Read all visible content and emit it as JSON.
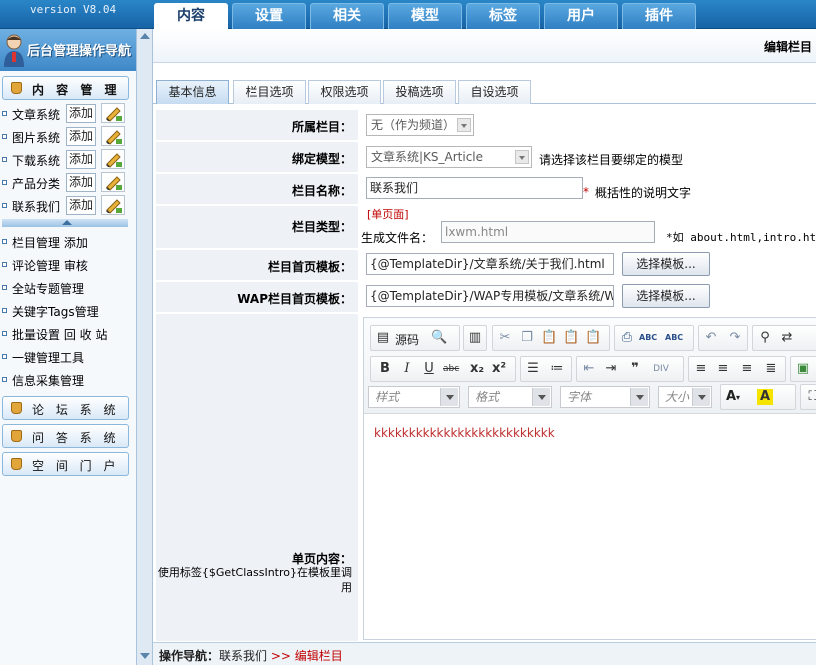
{
  "app": {
    "version": "version V8.04"
  },
  "top_tabs": [
    "内容",
    "设置",
    "相关",
    "模型",
    "标签",
    "用户",
    "插件"
  ],
  "sidebar": {
    "title": "后台管理操作导航",
    "content_section": "内 容 管 理",
    "systems": [
      {
        "label": "文章系统",
        "add": "添加"
      },
      {
        "label": "图片系统",
        "add": "添加"
      },
      {
        "label": "下载系统",
        "add": "添加"
      },
      {
        "label": "产品分类",
        "add": "添加"
      },
      {
        "label": "联系我们",
        "add": "添加"
      }
    ],
    "links": [
      "栏目管理 添加",
      "评论管理 审核",
      "全站专题管理",
      "关键字Tags管理",
      "批量设置 回 收 站",
      "一键管理工具",
      "信息采集管理"
    ],
    "other_sections": [
      "论 坛 系 统",
      "问 答 系 统",
      "空 间 门 户"
    ]
  },
  "page": {
    "title": "编辑栏目"
  },
  "sub_tabs": [
    "基本信息",
    "栏目选项",
    "权限选项",
    "投稿选项",
    "自设选项"
  ],
  "form": {
    "parent": {
      "label": "所属栏目：",
      "value": "无（作为频道）"
    },
    "model": {
      "label": "绑定模型：",
      "value": "文章系统|KS_Article",
      "hint": "请选择该栏目要绑定的模型"
    },
    "name": {
      "label": "栏目名称：",
      "value": "联系我们",
      "star": "*",
      "hint": "概括性的说明文字"
    },
    "type": {
      "label": "栏目类型：",
      "tag": "[单页面]",
      "filename_label": "生成文件名：",
      "filename_value": "lxwm.html",
      "hint": "*如 about.html,intro.html"
    },
    "home_tpl": {
      "label": "栏目首页模板：",
      "value": "{@TemplateDir}/文章系统/关于我们.html",
      "button": "选择模板..."
    },
    "wap_tpl": {
      "label": "WAP栏目首页模板：",
      "value": "{@TemplateDir}/WAP专用模板/文章系统/W",
      "button": "选择模板..."
    },
    "content": {
      "label": "单页内容：",
      "note": "使用标签{$GetClassIntro}在模板里调用"
    }
  },
  "editor": {
    "source_label": "源码",
    "style_placeholder": "样式",
    "format_placeholder": "格式",
    "font_placeholder": "字体",
    "size_placeholder": "大小",
    "body_text": "kkkkkkkkkkkkkkkkkkkkkkkkkk"
  },
  "breadcrumb": {
    "label": "操作导航：",
    "current": "联系我们",
    "sep": ">>",
    "action": "编辑栏目"
  },
  "colors": {
    "accent": "#1f6fb2",
    "warning": "#c00000"
  }
}
